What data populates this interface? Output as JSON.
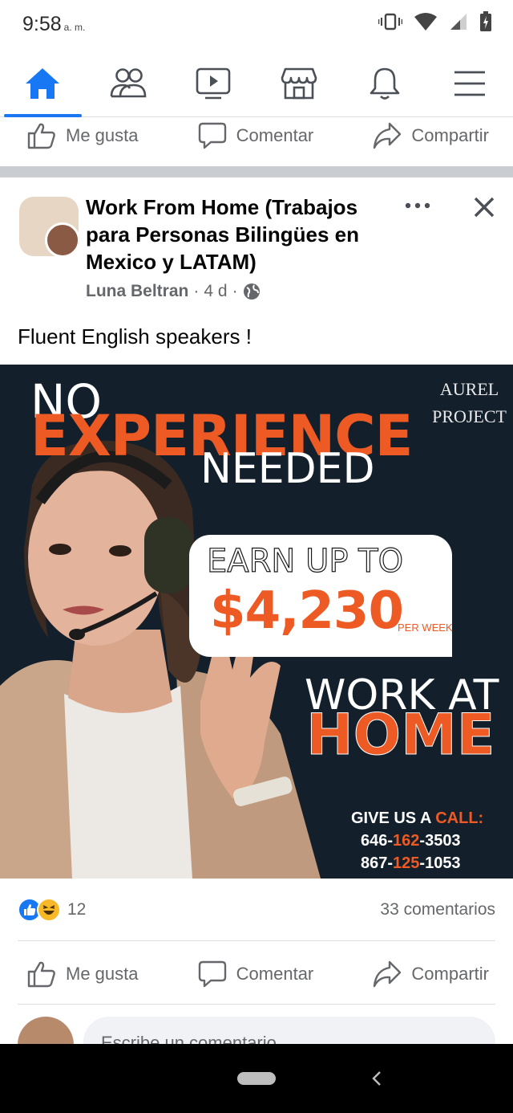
{
  "status_bar": {
    "time": "9:58",
    "ampm": "a. m."
  },
  "colors": {
    "accent": "#1877f2",
    "ad_orange": "#ee5a24",
    "ad_background": "#13202c"
  },
  "top_nav": {
    "items": [
      {
        "icon": "home-icon",
        "active": true
      },
      {
        "icon": "friends-icon",
        "active": false
      },
      {
        "icon": "watch-icon",
        "active": false
      },
      {
        "icon": "marketplace-icon",
        "active": false
      },
      {
        "icon": "notifications-icon",
        "active": false
      },
      {
        "icon": "menu-icon",
        "active": false
      }
    ]
  },
  "actions": {
    "like": "Me gusta",
    "comment": "Comentar",
    "share": "Compartir"
  },
  "post": {
    "group_name": "Work From Home (Trabajos para Personas Bilingües en Mexico y LATAM)",
    "author": "Luna Beltran",
    "time_ago": "4 d",
    "sep": "·",
    "text": "Fluent English speakers !",
    "ad": {
      "no": "NO",
      "experience": "EXPERIENCE",
      "needed": "NEEDED",
      "earn_up_to": "EARN UP TO",
      "amount": "$4,230",
      "per_week": "PER WEEK",
      "work_at": "WORK AT",
      "home": "HOME",
      "brand_line1": "AUREL",
      "brand_line2": "PROJECT",
      "call_prefix": "GIVE US A ",
      "call_accent": "CALL:",
      "phone1_a": "646-",
      "phone1_b": "162",
      "phone1_c": "-3503",
      "phone2_a": "867-",
      "phone2_b": "125",
      "phone2_c": "-1053"
    },
    "reaction_count": "12",
    "comments_count": "33 comentarios"
  },
  "composer": {
    "placeholder": "Escribe un comentario..."
  }
}
